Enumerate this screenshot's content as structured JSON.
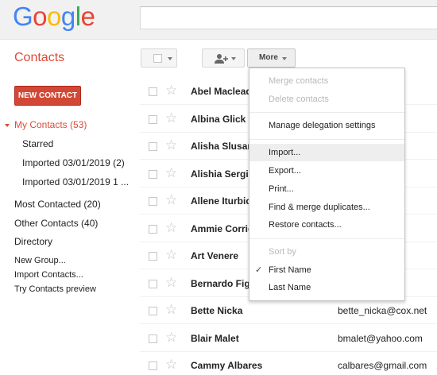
{
  "logo": {
    "letters": [
      {
        "char": "G",
        "color": "#4285f4"
      },
      {
        "char": "o",
        "color": "#ea4335"
      },
      {
        "char": "o",
        "color": "#fbbc05"
      },
      {
        "char": "g",
        "color": "#4285f4"
      },
      {
        "char": "l",
        "color": "#34a853"
      },
      {
        "char": "e",
        "color": "#ea4335"
      }
    ]
  },
  "app_title": "Contacts",
  "new_contact_label": "NEW CONTACT",
  "nav": {
    "my_contacts": "My Contacts (53)",
    "starred": "Starred",
    "imported_1": "Imported 03/01/2019 (2)",
    "imported_2": "Imported 03/01/2019 1 ...",
    "most_contacted": "Most Contacted (20)",
    "other_contacts": "Other Contacts (40)",
    "directory": "Directory",
    "new_group": "New Group...",
    "import_contacts": "Import Contacts...",
    "try_preview": "Try Contacts preview"
  },
  "toolbar": {
    "more_label": "More"
  },
  "contacts": [
    {
      "name": "Abel Maclead",
      "email": ".com"
    },
    {
      "name": "Albina Glick",
      "email": ""
    },
    {
      "name": "Alisha Slusars",
      "email": ".com"
    },
    {
      "name": "Alishia Sergi",
      "email": "m (+1)"
    },
    {
      "name": "Allene Iturbide",
      "email": "cox.net"
    },
    {
      "name": "Ammie Corrio",
      "email": "om"
    },
    {
      "name": "Art Venere",
      "email": ""
    },
    {
      "name": "Bernardo Fige",
      "email": "m"
    },
    {
      "name": "Bette Nicka",
      "email": "bette_nicka@cox.net"
    },
    {
      "name": "Blair Malet",
      "email": "bmalet@yahoo.com"
    },
    {
      "name": "Cammy Albares",
      "email": "calbares@gmail.com"
    }
  ],
  "menu": {
    "merge_contacts": "Merge contacts",
    "delete_contacts": "Delete contacts",
    "manage_delegation": "Manage delegation settings",
    "import": "Import...",
    "export": "Export...",
    "print": "Print...",
    "find_merge": "Find & merge duplicates...",
    "restore": "Restore contacts...",
    "sort_by": "Sort by",
    "first_name": "First Name",
    "last_name": "Last Name",
    "checkmark": "✓"
  }
}
